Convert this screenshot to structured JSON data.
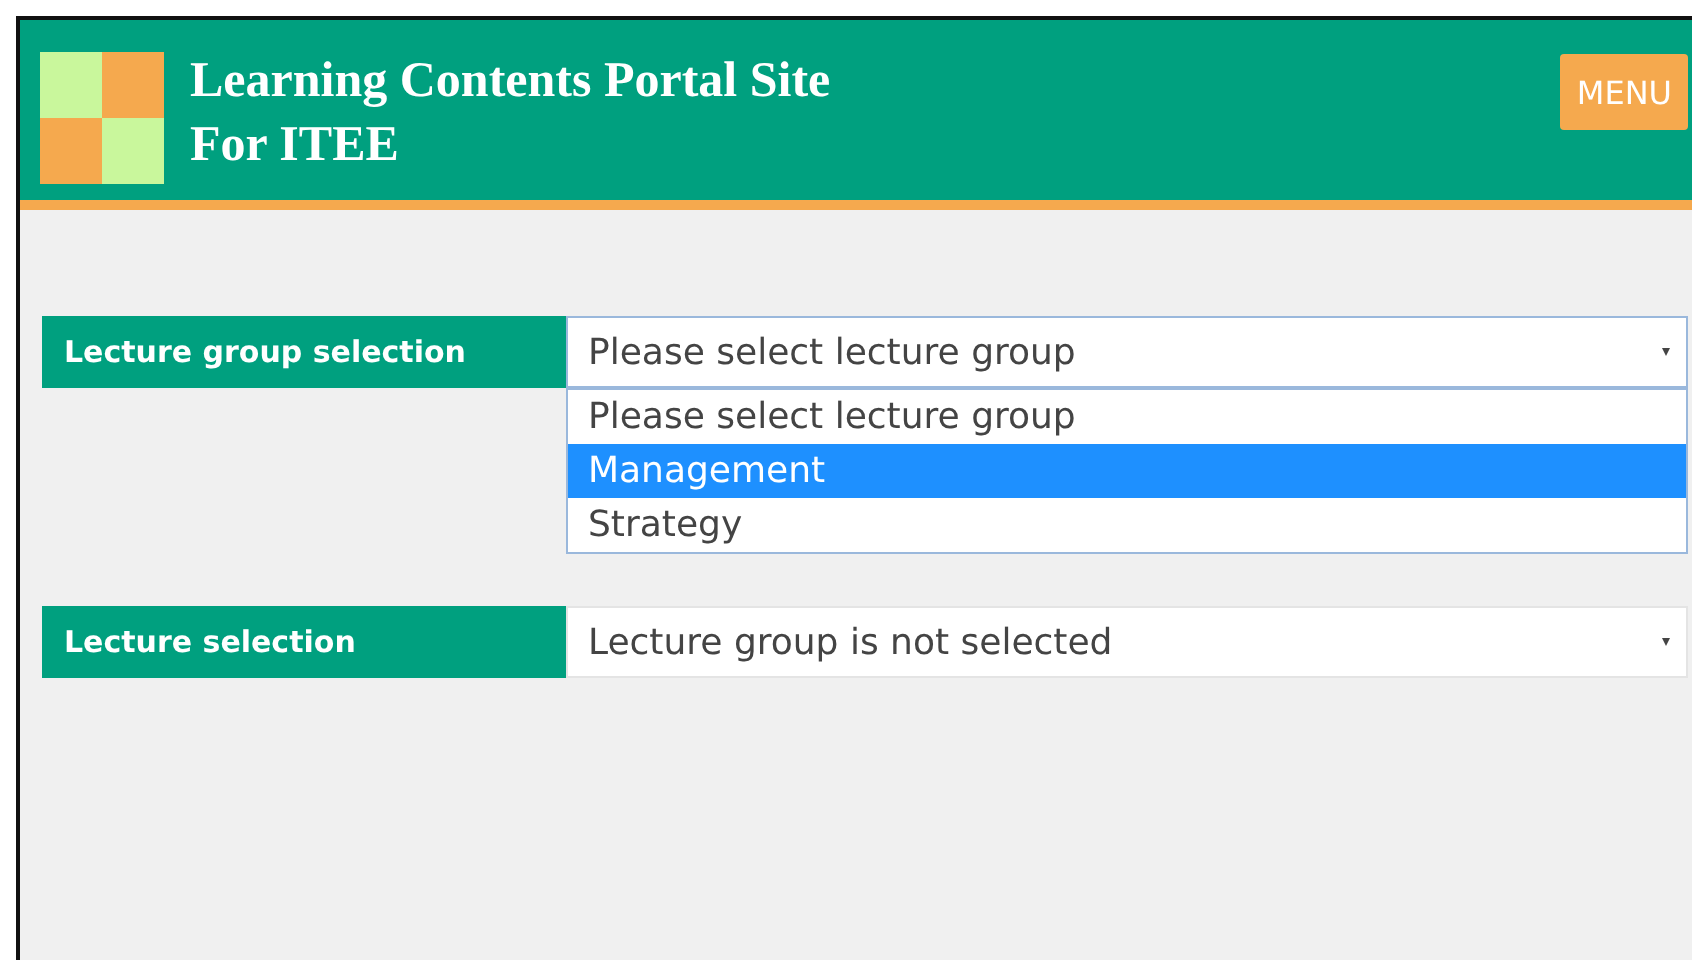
{
  "header": {
    "title_lines": [
      "Learning Contents Portal Site",
      "For ITEE"
    ],
    "menu_button": "MENU"
  },
  "fields": [
    {
      "label": "Lecture group selection",
      "value": "Please select lecture group",
      "expanded": true,
      "options": [
        {
          "label": "Please select lecture group",
          "highlighted": false
        },
        {
          "label": "Management",
          "highlighted": true
        },
        {
          "label": "Strategy",
          "highlighted": false
        }
      ]
    },
    {
      "label": "Lecture selection",
      "value": "Lecture group is not selected",
      "expanded": false
    }
  ]
}
